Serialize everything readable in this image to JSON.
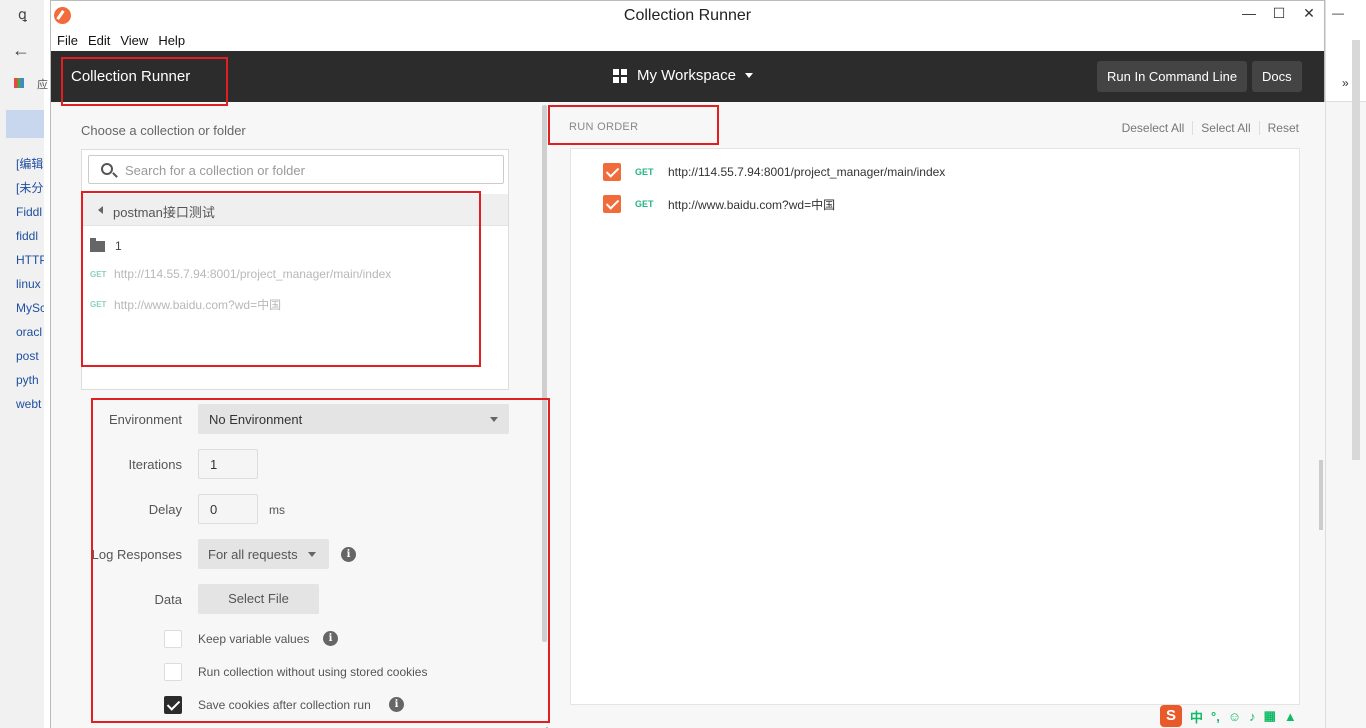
{
  "browser": {
    "links": [
      "[编辑",
      "[未分",
      "Fiddl",
      "fiddl",
      "HTTP",
      "linux",
      "MySc",
      "oracl",
      "post",
      "pyth",
      "webt"
    ],
    "apps_label": "应"
  },
  "window": {
    "title": "Collection Runner",
    "controls": {
      "minimize": "—",
      "maximize": "☐",
      "close": "✕"
    }
  },
  "menu": [
    "File",
    "Edit",
    "View",
    "Help"
  ],
  "header": {
    "title": "Collection Runner",
    "workspace": "My Workspace",
    "run_cmd_label": "Run In Command Line",
    "docs_label": "Docs"
  },
  "left": {
    "choose_label": "Choose a collection or folder",
    "search_placeholder": "Search for a collection or folder",
    "collection_name": "postman接口测试",
    "folder_name": "1",
    "requests": [
      {
        "method": "GET",
        "url": "http://114.55.7.94:8001/project_manager/main/index"
      },
      {
        "method": "GET",
        "url": "http://www.baidu.com?wd=中国"
      }
    ]
  },
  "form": {
    "environment_label": "Environment",
    "environment_value": "No Environment",
    "iterations_label": "Iterations",
    "iterations_value": "1",
    "delay_label": "Delay",
    "delay_value": "0",
    "delay_unit": "ms",
    "log_label": "Log Responses",
    "log_value": "For all requests",
    "data_label": "Data",
    "select_file": "Select File",
    "keep_vars": "Keep variable values",
    "no_cookies": "Run collection without using stored cookies",
    "save_cookies": "Save cookies after collection run",
    "keep_vars_checked": false,
    "no_cookies_checked": false,
    "save_cookies_checked": true
  },
  "right": {
    "run_order_label": "RUN ORDER",
    "deselect_all": "Deselect All",
    "select_all": "Select All",
    "reset": "Reset",
    "items": [
      {
        "method": "GET",
        "url": "http://114.55.7.94:8001/project_manager/main/index",
        "checked": true
      },
      {
        "method": "GET",
        "url": "http://www.baidu.com?wd=中国",
        "checked": true
      }
    ]
  },
  "ime": {
    "logo": "S",
    "mode": "中"
  },
  "colors": {
    "accent": "#f26b3a",
    "header_bg": "#2c2c2c",
    "annotation": "#e02020",
    "get_method": "#26b47f"
  }
}
